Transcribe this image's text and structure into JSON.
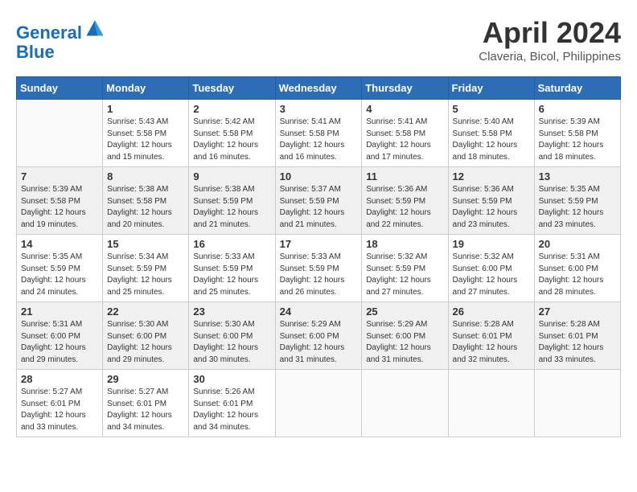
{
  "header": {
    "logo_line1": "General",
    "logo_line2": "Blue",
    "month_title": "April 2024",
    "location": "Claveria, Bicol, Philippines"
  },
  "weekdays": [
    "Sunday",
    "Monday",
    "Tuesday",
    "Wednesday",
    "Thursday",
    "Friday",
    "Saturday"
  ],
  "weeks": [
    [
      null,
      {
        "day": "1",
        "sunrise": "5:43 AM",
        "sunset": "5:58 PM",
        "daylight": "12 hours and 15 minutes."
      },
      {
        "day": "2",
        "sunrise": "5:42 AM",
        "sunset": "5:58 PM",
        "daylight": "12 hours and 16 minutes."
      },
      {
        "day": "3",
        "sunrise": "5:41 AM",
        "sunset": "5:58 PM",
        "daylight": "12 hours and 16 minutes."
      },
      {
        "day": "4",
        "sunrise": "5:41 AM",
        "sunset": "5:58 PM",
        "daylight": "12 hours and 17 minutes."
      },
      {
        "day": "5",
        "sunrise": "5:40 AM",
        "sunset": "5:58 PM",
        "daylight": "12 hours and 18 minutes."
      },
      {
        "day": "6",
        "sunrise": "5:39 AM",
        "sunset": "5:58 PM",
        "daylight": "12 hours and 18 minutes."
      }
    ],
    [
      {
        "day": "7",
        "sunrise": "5:39 AM",
        "sunset": "5:58 PM",
        "daylight": "12 hours and 19 minutes."
      },
      {
        "day": "8",
        "sunrise": "5:38 AM",
        "sunset": "5:58 PM",
        "daylight": "12 hours and 20 minutes."
      },
      {
        "day": "9",
        "sunrise": "5:38 AM",
        "sunset": "5:59 PM",
        "daylight": "12 hours and 21 minutes."
      },
      {
        "day": "10",
        "sunrise": "5:37 AM",
        "sunset": "5:59 PM",
        "daylight": "12 hours and 21 minutes."
      },
      {
        "day": "11",
        "sunrise": "5:36 AM",
        "sunset": "5:59 PM",
        "daylight": "12 hours and 22 minutes."
      },
      {
        "day": "12",
        "sunrise": "5:36 AM",
        "sunset": "5:59 PM",
        "daylight": "12 hours and 23 minutes."
      },
      {
        "day": "13",
        "sunrise": "5:35 AM",
        "sunset": "5:59 PM",
        "daylight": "12 hours and 23 minutes."
      }
    ],
    [
      {
        "day": "14",
        "sunrise": "5:35 AM",
        "sunset": "5:59 PM",
        "daylight": "12 hours and 24 minutes."
      },
      {
        "day": "15",
        "sunrise": "5:34 AM",
        "sunset": "5:59 PM",
        "daylight": "12 hours and 25 minutes."
      },
      {
        "day": "16",
        "sunrise": "5:33 AM",
        "sunset": "5:59 PM",
        "daylight": "12 hours and 25 minutes."
      },
      {
        "day": "17",
        "sunrise": "5:33 AM",
        "sunset": "5:59 PM",
        "daylight": "12 hours and 26 minutes."
      },
      {
        "day": "18",
        "sunrise": "5:32 AM",
        "sunset": "5:59 PM",
        "daylight": "12 hours and 27 minutes."
      },
      {
        "day": "19",
        "sunrise": "5:32 AM",
        "sunset": "6:00 PM",
        "daylight": "12 hours and 27 minutes."
      },
      {
        "day": "20",
        "sunrise": "5:31 AM",
        "sunset": "6:00 PM",
        "daylight": "12 hours and 28 minutes."
      }
    ],
    [
      {
        "day": "21",
        "sunrise": "5:31 AM",
        "sunset": "6:00 PM",
        "daylight": "12 hours and 29 minutes."
      },
      {
        "day": "22",
        "sunrise": "5:30 AM",
        "sunset": "6:00 PM",
        "daylight": "12 hours and 29 minutes."
      },
      {
        "day": "23",
        "sunrise": "5:30 AM",
        "sunset": "6:00 PM",
        "daylight": "12 hours and 30 minutes."
      },
      {
        "day": "24",
        "sunrise": "5:29 AM",
        "sunset": "6:00 PM",
        "daylight": "12 hours and 31 minutes."
      },
      {
        "day": "25",
        "sunrise": "5:29 AM",
        "sunset": "6:00 PM",
        "daylight": "12 hours and 31 minutes."
      },
      {
        "day": "26",
        "sunrise": "5:28 AM",
        "sunset": "6:01 PM",
        "daylight": "12 hours and 32 minutes."
      },
      {
        "day": "27",
        "sunrise": "5:28 AM",
        "sunset": "6:01 PM",
        "daylight": "12 hours and 33 minutes."
      }
    ],
    [
      {
        "day": "28",
        "sunrise": "5:27 AM",
        "sunset": "6:01 PM",
        "daylight": "12 hours and 33 minutes."
      },
      {
        "day": "29",
        "sunrise": "5:27 AM",
        "sunset": "6:01 PM",
        "daylight": "12 hours and 34 minutes."
      },
      {
        "day": "30",
        "sunrise": "5:26 AM",
        "sunset": "6:01 PM",
        "daylight": "12 hours and 34 minutes."
      },
      null,
      null,
      null,
      null
    ]
  ]
}
